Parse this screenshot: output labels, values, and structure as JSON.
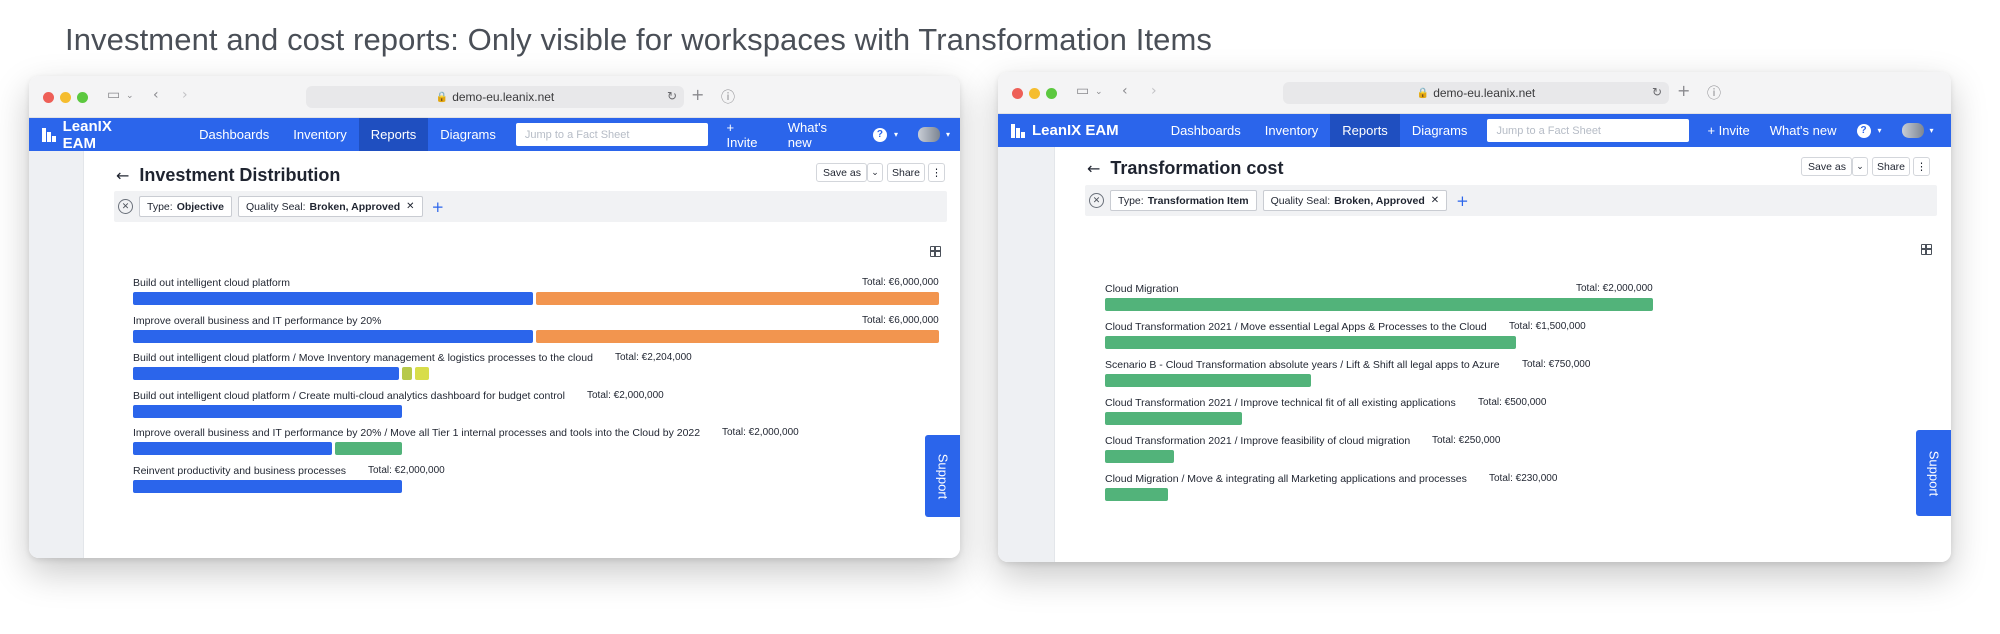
{
  "page": {
    "heading": "Investment and cost reports: Only visible for workspaces with Transformation Items"
  },
  "nav": {
    "brand": "LeanIX EAM",
    "items": [
      "Dashboards",
      "Inventory",
      "Reports",
      "Diagrams"
    ],
    "active": "Reports",
    "search_placeholder": "Jump to a Fact Sheet",
    "invite": "+ Invite",
    "whats_new": "What's new",
    "help": "?"
  },
  "colors": {
    "blue": "#2b65eb",
    "orange": "#f2954f",
    "green": "#52b37a",
    "light_green": "#b7c94a",
    "yellow": "#d8dd4a"
  },
  "left_window": {
    "url": "demo-eu.leanix.net",
    "title": "Investment Distribution",
    "save_as": "Save as",
    "share": "Share",
    "filters": [
      {
        "key": "Type:",
        "value": "Objective",
        "removable": false
      },
      {
        "key": "Quality Seal:",
        "value": "Broken, Approved",
        "removable": true
      }
    ],
    "support": "Support",
    "scale_max": 6000000,
    "rows": [
      {
        "label": "Build out intelligent cloud platform",
        "total": "Total: €6,000,000",
        "segments": [
          {
            "value": 3000000,
            "color": "blue"
          },
          {
            "value": 3000000,
            "color": "orange"
          }
        ]
      },
      {
        "label": "Improve overall business and IT performance by 20%",
        "total": "Total: €6,000,000",
        "segments": [
          {
            "value": 3000000,
            "color": "blue"
          },
          {
            "value": 3000000,
            "color": "orange"
          }
        ]
      },
      {
        "label": "Build out intelligent cloud platform / Move Inventory management & logistics processes to the cloud",
        "total": "Total: €2,204,000",
        "segments": [
          {
            "value": 2000000,
            "color": "blue"
          },
          {
            "value": 102000,
            "color": "light_green"
          },
          {
            "value": 102000,
            "color": "yellow"
          }
        ]
      },
      {
        "label": "Build out intelligent cloud platform / Create multi-cloud analytics dashboard for budget control",
        "total": "Total: €2,000,000",
        "segments": [
          {
            "value": 2000000,
            "color": "blue"
          }
        ]
      },
      {
        "label": "Improve overall business and IT performance by 20% / Move all Tier 1 internal processes and tools into the Cloud by 2022",
        "total": "Total: €2,000,000",
        "segments": [
          {
            "value": 1500000,
            "color": "blue"
          },
          {
            "value": 500000,
            "color": "green"
          }
        ]
      },
      {
        "label": "Reinvent productivity and business processes",
        "total": "Total: €2,000,000",
        "segments": [
          {
            "value": 2000000,
            "color": "blue"
          }
        ]
      }
    ]
  },
  "right_window": {
    "url": "demo-eu.leanix.net",
    "title": "Transformation cost",
    "save_as": "Save as",
    "share": "Share",
    "filters": [
      {
        "key": "Type:",
        "value": "Transformation Item",
        "removable": false
      },
      {
        "key": "Quality Seal:",
        "value": "Broken, Approved",
        "removable": true
      }
    ],
    "support": "Support",
    "scale_max": 2000000,
    "rows": [
      {
        "label": "Cloud Migration",
        "total": "Total: €2,000,000",
        "segments": [
          {
            "value": 2000000,
            "color": "green"
          }
        ]
      },
      {
        "label": "Cloud Transformation 2021 / Move essential Legal Apps & Processes to the Cloud",
        "total": "Total: €1,500,000",
        "segments": [
          {
            "value": 1500000,
            "color": "green"
          }
        ]
      },
      {
        "label": "Scenario B - Cloud Transformation absolute years / Lift & Shift all legal apps to Azure",
        "total": "Total: €750,000",
        "segments": [
          {
            "value": 750000,
            "color": "green"
          }
        ]
      },
      {
        "label": "Cloud Transformation 2021 / Improve technical fit of all existing applications",
        "total": "Total: €500,000",
        "segments": [
          {
            "value": 500000,
            "color": "green"
          }
        ]
      },
      {
        "label": "Cloud Transformation 2021 / Improve feasibility of cloud migration",
        "total": "Total: €250,000",
        "segments": [
          {
            "value": 250000,
            "color": "green"
          }
        ]
      },
      {
        "label": "Cloud Migration / Move & integrating all Marketing applications and processes",
        "total": "Total: €230,000",
        "segments": [
          {
            "value": 230000,
            "color": "green"
          }
        ]
      }
    ]
  }
}
